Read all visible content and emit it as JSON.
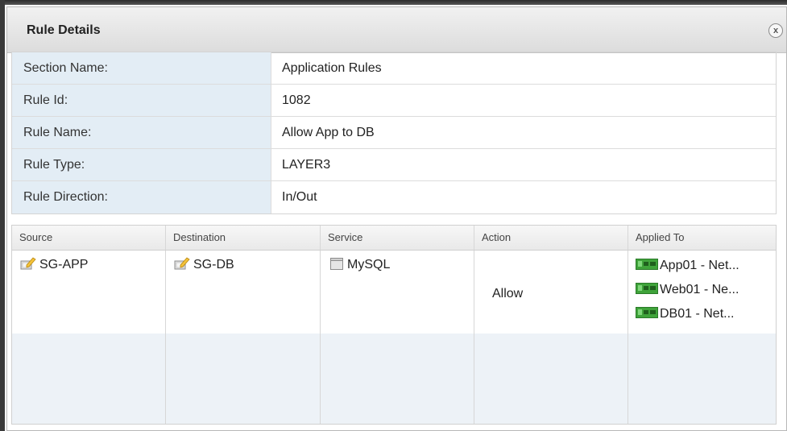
{
  "dialog": {
    "title": "Rule Details",
    "close_label": "x"
  },
  "properties": [
    {
      "label": "Section Name:",
      "value": "Application Rules"
    },
    {
      "label": "Rule Id:",
      "value": "1082"
    },
    {
      "label": "Rule Name:",
      "value": "Allow App to DB"
    },
    {
      "label": "Rule Type:",
      "value": "LAYER3"
    },
    {
      "label": "Rule Direction:",
      "value": "In/Out"
    }
  ],
  "grid": {
    "columns": [
      "Source",
      "Destination",
      "Service",
      "Action",
      "Applied To"
    ],
    "row": {
      "source": "SG-APP",
      "destination": "SG-DB",
      "service": "MySQL",
      "action": "Allow",
      "applied_to": [
        "App01 - Net...",
        "Web01 - Ne...",
        "DB01 - Net..."
      ]
    }
  },
  "icons": {
    "security_group": "security-group-icon",
    "service": "service-icon",
    "network_adapter": "network-adapter-icon"
  },
  "colors": {
    "label_bg": "#e3edf5",
    "alt_row_bg": "#edf2f7",
    "nic_green": "#3fa33a"
  }
}
